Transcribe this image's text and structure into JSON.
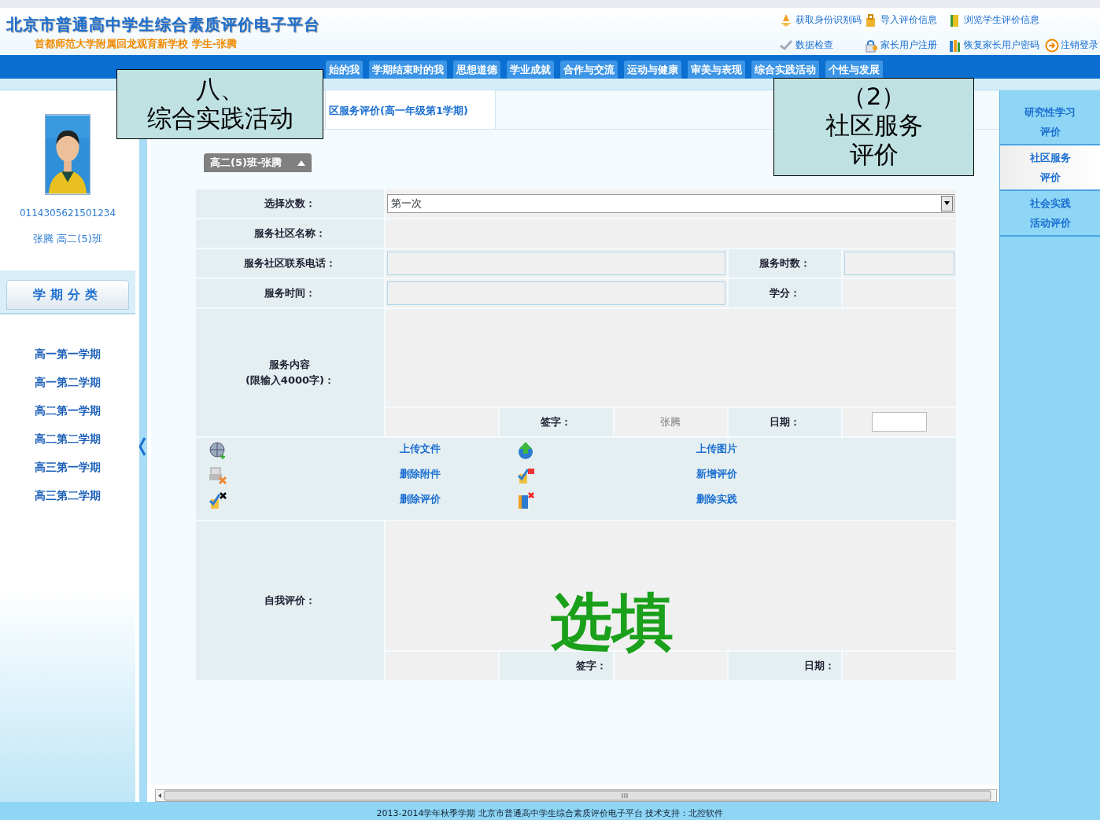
{
  "header": {
    "title": "北京市普通高中学生综合素质评价电子平台",
    "subtitle": "首都师范大学附属回龙观育新学校  学生-张腾"
  },
  "top_links": [
    {
      "label": "获取身份识别码"
    },
    {
      "label": "导入评价信息"
    },
    {
      "label": "浏览学生评价信息"
    },
    {
      "label": "数据检查"
    },
    {
      "label": "家长用户注册"
    },
    {
      "label": "恢复家长用户密码"
    },
    {
      "label": "注销登录"
    }
  ],
  "nav_tabs": [
    {
      "label": "始的我",
      "selected": false
    },
    {
      "label": "学期结束时的我",
      "selected": false
    },
    {
      "label": "思想道德",
      "selected": false
    },
    {
      "label": "学业成就",
      "selected": false
    },
    {
      "label": "合作与交流",
      "selected": false
    },
    {
      "label": "运动与健康",
      "selected": false
    },
    {
      "label": "审美与表现",
      "selected": false
    },
    {
      "label": "综合实践活动",
      "selected": false
    },
    {
      "label": "个性与发展",
      "selected": false
    }
  ],
  "student": {
    "id": "0114305621501234",
    "name_class": "张腾 高二(5)班"
  },
  "semester_heading": "学期分类",
  "semesters": [
    {
      "label": "高一第一学期"
    },
    {
      "label": "高一第二学期"
    },
    {
      "label": "高二第一学期"
    },
    {
      "label": "高二第二学期"
    },
    {
      "label": "高三第一学期"
    },
    {
      "label": "高三第二学期"
    }
  ],
  "page_tab": {
    "label": "区服务评价(高一年级第1学期)"
  },
  "class_dropdown": {
    "label": "高二(5)班-张腾"
  },
  "form": {
    "times_label": "选择次数：",
    "times_value": "第一次",
    "community_label": "服务社区名称：",
    "phone_label": "服务社区联系电话：",
    "hours_label": "服务时数：",
    "time_label": "服务时间：",
    "credit_label": "学分：",
    "content_label": [
      "服务内容",
      "(限输入4000字)："
    ],
    "sign_label": "签字：",
    "signer": "张腾",
    "date_label": "日期：",
    "self_eval_label": "自我评价：",
    "self_sign_label": "签字：",
    "self_date_label": "日期："
  },
  "actions": [
    {
      "label": "上传文件"
    },
    {
      "label": "上传图片"
    },
    {
      "label": "删除附件"
    },
    {
      "label": "新增评价"
    },
    {
      "label": "删除评价"
    },
    {
      "label": "删除实践"
    }
  ],
  "right_menu": [
    {
      "lines": [
        "研究性学习",
        "评价"
      ],
      "selected": false
    },
    {
      "lines": [
        "社区服务",
        "评价"
      ],
      "selected": true
    },
    {
      "lines": [
        "社会实践",
        "活动评价"
      ],
      "selected": false
    }
  ],
  "callouts": [
    {
      "lines": [
        "八、",
        "综合实践活动"
      ]
    },
    {
      "lines": [
        "（2）",
        "社区服务",
        "评价"
      ]
    }
  ],
  "annotation": "选填",
  "footer": "2013-2014学年秋季学期 北京市普通高中学生综合素质评价电子平台 技术支持：北控软件"
}
